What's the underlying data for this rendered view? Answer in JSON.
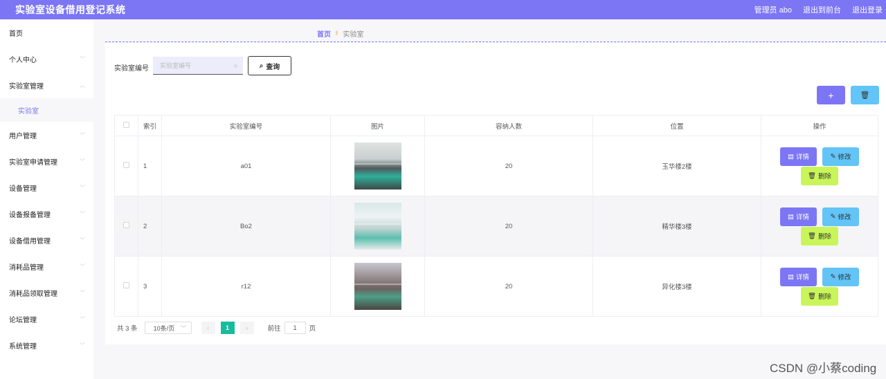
{
  "header": {
    "title": "实验室设备借用登记系统",
    "user": "管理员 abo",
    "to_front": "退出到前台",
    "logout": "退出登录"
  },
  "sidebar": {
    "items": [
      {
        "label": "首页",
        "has_chevron": false
      },
      {
        "label": "个人中心",
        "has_chevron": true
      },
      {
        "label": "实验室管理",
        "has_chevron": true,
        "expanded": true
      },
      {
        "label": "实验室",
        "sub": true,
        "active": true
      },
      {
        "label": "用户管理",
        "has_chevron": true
      },
      {
        "label": "实验室申请管理",
        "has_chevron": true
      },
      {
        "label": "设备管理",
        "has_chevron": true
      },
      {
        "label": "设备报备管理",
        "has_chevron": true
      },
      {
        "label": "设备借用管理",
        "has_chevron": true
      },
      {
        "label": "消耗品管理",
        "has_chevron": true
      },
      {
        "label": "消耗品领取管理",
        "has_chevron": true
      },
      {
        "label": "论坛管理",
        "has_chevron": true
      },
      {
        "label": "系统管理",
        "has_chevron": true
      }
    ]
  },
  "breadcrumb": {
    "home": "首页",
    "separator_icon": "✌",
    "current": "实验室"
  },
  "search": {
    "label": "实验室编号",
    "placeholder": "实验室编号",
    "value": "",
    "query_button": "查询"
  },
  "actions": {
    "add_icon": "plus-icon",
    "delete_icon": "trash-icon"
  },
  "table": {
    "columns": [
      "索引",
      "实验室编号",
      "图片",
      "容纳人数",
      "位置",
      "操作"
    ],
    "rows": [
      {
        "index": "1",
        "code": "a01",
        "image": "lab-photo-1",
        "capacity": "20",
        "location": "玉华楼2楼"
      },
      {
        "index": "2",
        "code": "Bo2",
        "image": "lab-photo-2",
        "capacity": "20",
        "location": "精华楼3楼"
      },
      {
        "index": "3",
        "code": "r12",
        "image": "lab-photo-3",
        "capacity": "20",
        "location": "异化楼3楼"
      }
    ],
    "op_labels": {
      "detail": "详情",
      "edit": "修改",
      "delete": "删除"
    }
  },
  "pagination": {
    "total": "共 3 条",
    "page_size": "10条/页",
    "current_page": "1",
    "goto_label": "前往",
    "goto_value": "1",
    "page_unit": "页"
  },
  "watermark": "CSDN @小蔡coding",
  "colors": {
    "primary": "#7c76f5",
    "info": "#62c4f7",
    "warn": "#c9f55a",
    "pager_active": "#18bc9c"
  }
}
